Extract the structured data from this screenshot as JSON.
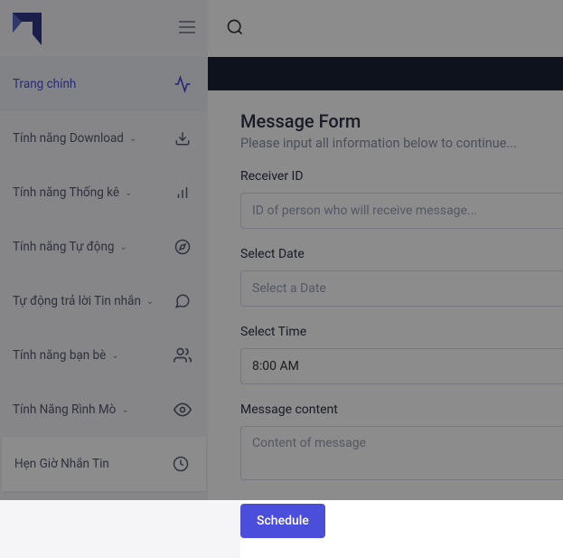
{
  "sidebar": {
    "items": [
      {
        "label": "Trang chính"
      },
      {
        "label": "Tính năng Download"
      },
      {
        "label": "Tính năng Thống kê"
      },
      {
        "label": "Tính năng Tự động"
      },
      {
        "label": "Tự động trả lời Tin nhắn"
      },
      {
        "label": "Tính năng bạn bè"
      },
      {
        "label": "Tính Năng Rình Mò"
      },
      {
        "label": "Hẹn Giờ Nhắn Tin"
      }
    ]
  },
  "form": {
    "title": "Message Form",
    "subtitle": "Please input all information below to continue...",
    "receiver_label": "Receiver ID",
    "receiver_placeholder": "ID of person who will receive message...",
    "date_label": "Select Date",
    "date_placeholder": "Select a Date",
    "time_label": "Select Time",
    "time_value": "8:00 AM",
    "content_label": "Message content",
    "content_placeholder": "Content of message",
    "submit_label": "Schedule"
  }
}
